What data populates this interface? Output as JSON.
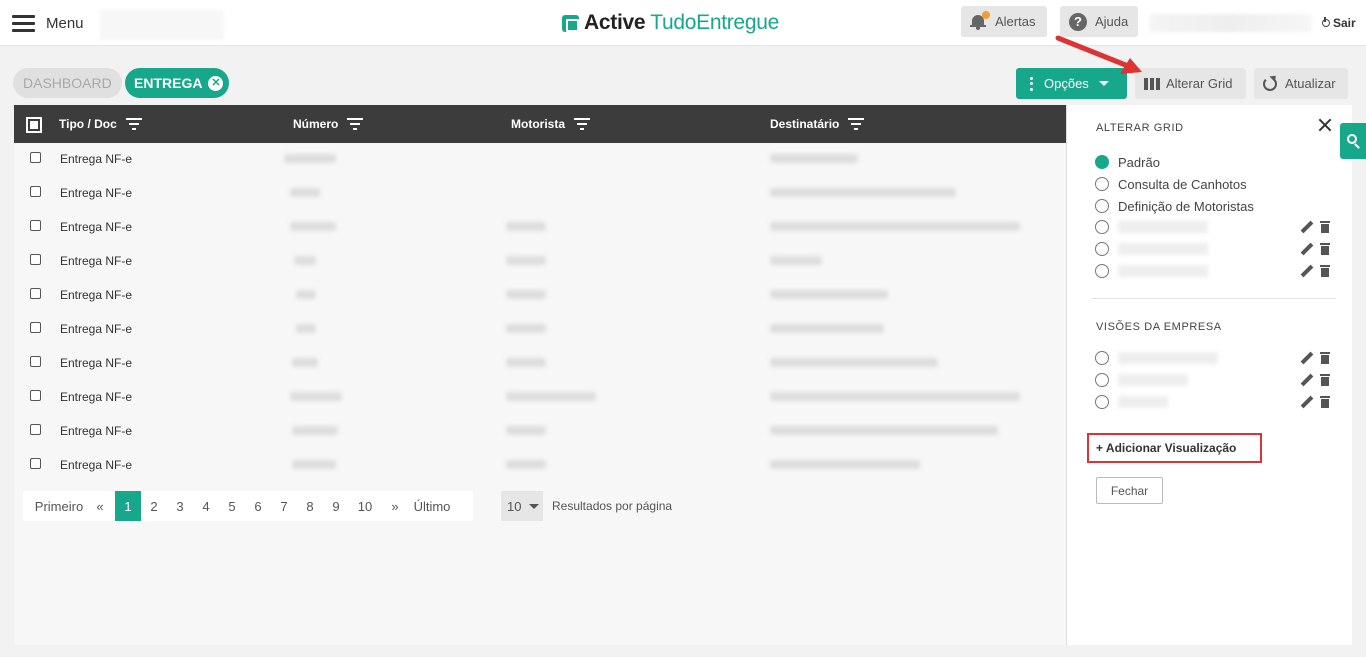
{
  "header": {
    "menu_label": "Menu",
    "logo_active": "Active",
    "logo_tudo": "TudoEntregue",
    "alerts_label": "Alertas",
    "help_label": "Ajuda",
    "logout_label": "Sair"
  },
  "breadcrumb": {
    "dashboard": "DASHBOARD",
    "entrega": "ENTREGA",
    "close_glyph": "✕"
  },
  "toolbar": {
    "options_label": "Opções",
    "alter_grid_label": "Alterar Grid",
    "refresh_label": "Atualizar"
  },
  "table": {
    "columns": [
      "Tipo / Doc",
      "Número",
      "Motorista",
      "Destinatário"
    ],
    "rows": [
      {
        "type": "Entrega NF-e"
      },
      {
        "type": "Entrega NF-e"
      },
      {
        "type": "Entrega NF-e"
      },
      {
        "type": "Entrega NF-e"
      },
      {
        "type": "Entrega NF-e"
      },
      {
        "type": "Entrega NF-e"
      },
      {
        "type": "Entrega NF-e"
      },
      {
        "type": "Entrega NF-e"
      },
      {
        "type": "Entrega NF-e"
      },
      {
        "type": "Entrega NF-e"
      }
    ]
  },
  "pagination": {
    "first": "Primeiro",
    "prev": "«",
    "pages": [
      "1",
      "2",
      "3",
      "4",
      "5",
      "6",
      "7",
      "8",
      "9",
      "10"
    ],
    "active_page": "1",
    "next": "»",
    "last": "Último",
    "per_page_value": "10",
    "per_page_label": "Resultados por página"
  },
  "side_panel": {
    "title": "ALTERAR GRID",
    "options": [
      "Padrão",
      "Consulta de Canhotos",
      "Definição de Motoristas"
    ],
    "selected_option": "Padrão",
    "company_views_title": "VISÕES DA EMPRESA",
    "add_view_label": "+ Adicionar Visualização",
    "close_label": "Fechar"
  },
  "colors": {
    "accent": "#17a88c",
    "header_dark": "#3c3c3c",
    "highlight": "#dd3333"
  },
  "icons": [
    "hamburger-icon",
    "bell-icon",
    "help-icon",
    "power-icon",
    "close-icon",
    "vertical-dots-icon",
    "caret-down-icon",
    "columns-icon",
    "refresh-icon",
    "filter-icon",
    "pencil-icon",
    "trash-icon",
    "search-icon"
  ]
}
